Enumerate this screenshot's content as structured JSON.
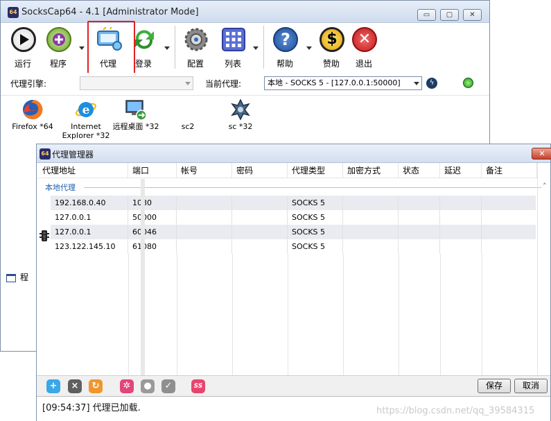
{
  "main_window": {
    "title": "SocksCap64 - 4.1 [Administrator Mode]",
    "app_icon_text": "64",
    "controls": {
      "minimize": "▭",
      "maximize": "▢",
      "close": "✕"
    }
  },
  "toolbar": {
    "items": [
      {
        "label": "运行",
        "icon": "play-icon"
      },
      {
        "label": "程序",
        "icon": "add-program-icon"
      },
      {
        "label": "代理",
        "icon": "proxy-icon"
      },
      {
        "label": "登录",
        "icon": "login-sync-icon"
      },
      {
        "label": "配置",
        "icon": "gear-icon"
      },
      {
        "label": "列表",
        "icon": "grid-list-icon"
      },
      {
        "label": "帮助",
        "icon": "help-icon"
      },
      {
        "label": "赞助",
        "icon": "dollar-icon"
      },
      {
        "label": "退出",
        "icon": "exit-icon"
      }
    ]
  },
  "proxy_row": {
    "engine_label": "代理引擎:",
    "engine_value": "",
    "current_label": "当前代理:",
    "current_value": "本地 - SOCKS 5 - [127.0.0.1:50000]"
  },
  "apps": [
    {
      "label": "Firefox *64",
      "icon": "firefox-icon"
    },
    {
      "label": "Internet Explorer *32",
      "icon": "internet-explorer-icon"
    },
    {
      "label": "远程桌面 *32",
      "icon": "remote-desktop-icon"
    },
    {
      "label": "sc2",
      "icon": "none"
    },
    {
      "label": "sc *32",
      "icon": "starcraft-icon"
    }
  ],
  "left_stub_label": "程",
  "dialog": {
    "title": "代理管理器",
    "app_icon_text": "64",
    "close": "✕",
    "columns": [
      "代理地址",
      "端口",
      "帐号",
      "密码",
      "代理类型",
      "加密方式",
      "状态",
      "延迟",
      "备注"
    ],
    "group_label": "本地代理",
    "rows": [
      [
        "192.168.0.40",
        "1080",
        "",
        "",
        "SOCKS 5",
        "",
        "",
        "",
        ""
      ],
      [
        "127.0.0.1",
        "50000",
        "",
        "",
        "SOCKS 5",
        "",
        "",
        "",
        ""
      ],
      [
        "127.0.0.1",
        "60046",
        "",
        "",
        "SOCKS 5",
        "",
        "",
        "",
        ""
      ],
      [
        "123.122.145.10",
        "61080",
        "",
        "",
        "SOCKS 5",
        "",
        "",
        "",
        ""
      ]
    ],
    "bottom_icons": [
      {
        "glyph": "+",
        "name": "add-proxy-icon",
        "color": "#3aa7e6"
      },
      {
        "glyph": "×",
        "name": "delete-proxy-icon",
        "color": "#5f5f5f"
      },
      {
        "glyph": "↻",
        "name": "refresh-proxy-icon",
        "color": "#f0962e"
      },
      {
        "glyph": "✲",
        "name": "settings-proxy-icon",
        "color": "#e3447a"
      },
      {
        "glyph": "●",
        "name": "bulb-icon",
        "color": "#9a9a9a"
      },
      {
        "glyph": "✓",
        "name": "check-proxy-icon",
        "color": "#8f8f8f"
      },
      {
        "glyph": "SS",
        "name": "shadowsocks-icon",
        "color": "#e8456e"
      }
    ],
    "save_label": "保存",
    "cancel_label": "取消",
    "log_text": "[09:54:37]  代理已加载.",
    "watermark": "https://blog.csdn.net/qq_39584315"
  }
}
